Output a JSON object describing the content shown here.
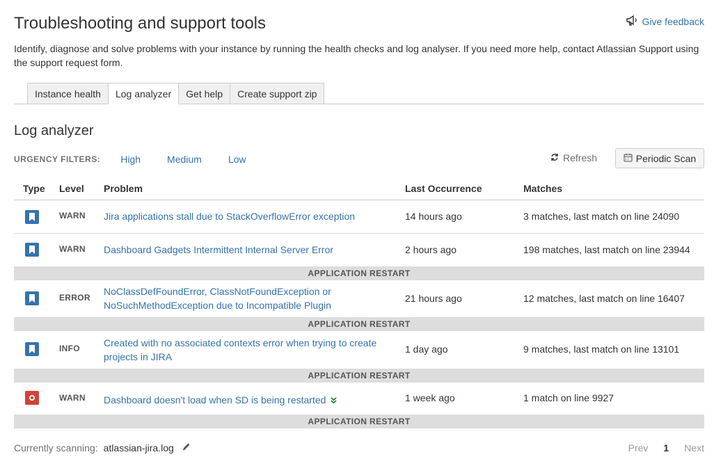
{
  "header": {
    "title": "Troubleshooting and support tools",
    "feedback_label": "Give feedback",
    "intro": "Identify, diagnose and solve problems with your instance by running the health checks and log analyser. If you need more help, contact Atlassian Support using the support request form."
  },
  "tabs": [
    {
      "label": "Instance health",
      "active": false
    },
    {
      "label": "Log analyzer",
      "active": true
    },
    {
      "label": "Get help",
      "active": false
    },
    {
      "label": "Create support zip",
      "active": false
    }
  ],
  "section_title": "Log analyzer",
  "filters": {
    "label": "URGENCY FILTERS:",
    "items": [
      "High",
      "Medium",
      "Low"
    ]
  },
  "toolbar": {
    "refresh_label": "Refresh",
    "periodic_label": "Periodic Scan"
  },
  "table": {
    "headers": {
      "type": "Type",
      "level": "Level",
      "problem": "Problem",
      "last": "Last Occurrence",
      "matches": "Matches"
    },
    "restart_label": "APPLICATION RESTART",
    "rows": [
      {
        "icon": "bookmark-icon",
        "level": "WARN",
        "problem": "Jira applications stall due to StackOverflowError exception",
        "last": "14 hours ago",
        "matches": "3 matches, last match on line 24090"
      },
      {
        "icon": "bookmark-icon",
        "level": "WARN",
        "problem": "Dashboard Gadgets Intermittent Internal Server Error",
        "last": "2 hours ago",
        "matches": "198 matches, last match on line 23944"
      },
      {
        "icon": "bookmark-icon",
        "level": "ERROR",
        "problem": "NoClassDefFoundError, ClassNotFoundException or NoSuchMethodException due to Incompatible Plugin",
        "last": "21 hours ago",
        "matches": "12 matches, last match on line 16407"
      },
      {
        "icon": "bookmark-icon",
        "level": "INFO",
        "problem": "Created with no associated contexts error when trying to create projects in JIRA",
        "last": "1 day ago",
        "matches": "9 matches, last match on line 13101"
      },
      {
        "icon": "record-icon",
        "level": "WARN",
        "problem": "Dashboard doesn't load when SD is being restarted",
        "last": "1 week ago",
        "matches": "1 match on line 9927"
      }
    ]
  },
  "footer": {
    "scanning_label": "Currently scanning:",
    "file": "atlassian-jira.log",
    "pager": {
      "prev": "Prev",
      "current": "1",
      "next": "Next"
    }
  },
  "colors": {
    "link": "#3572b0",
    "bookmark_icon": "#3572b0",
    "record_icon": "#d04437",
    "restart_bar": "#dddddd",
    "double_chevron": "#14892c"
  }
}
